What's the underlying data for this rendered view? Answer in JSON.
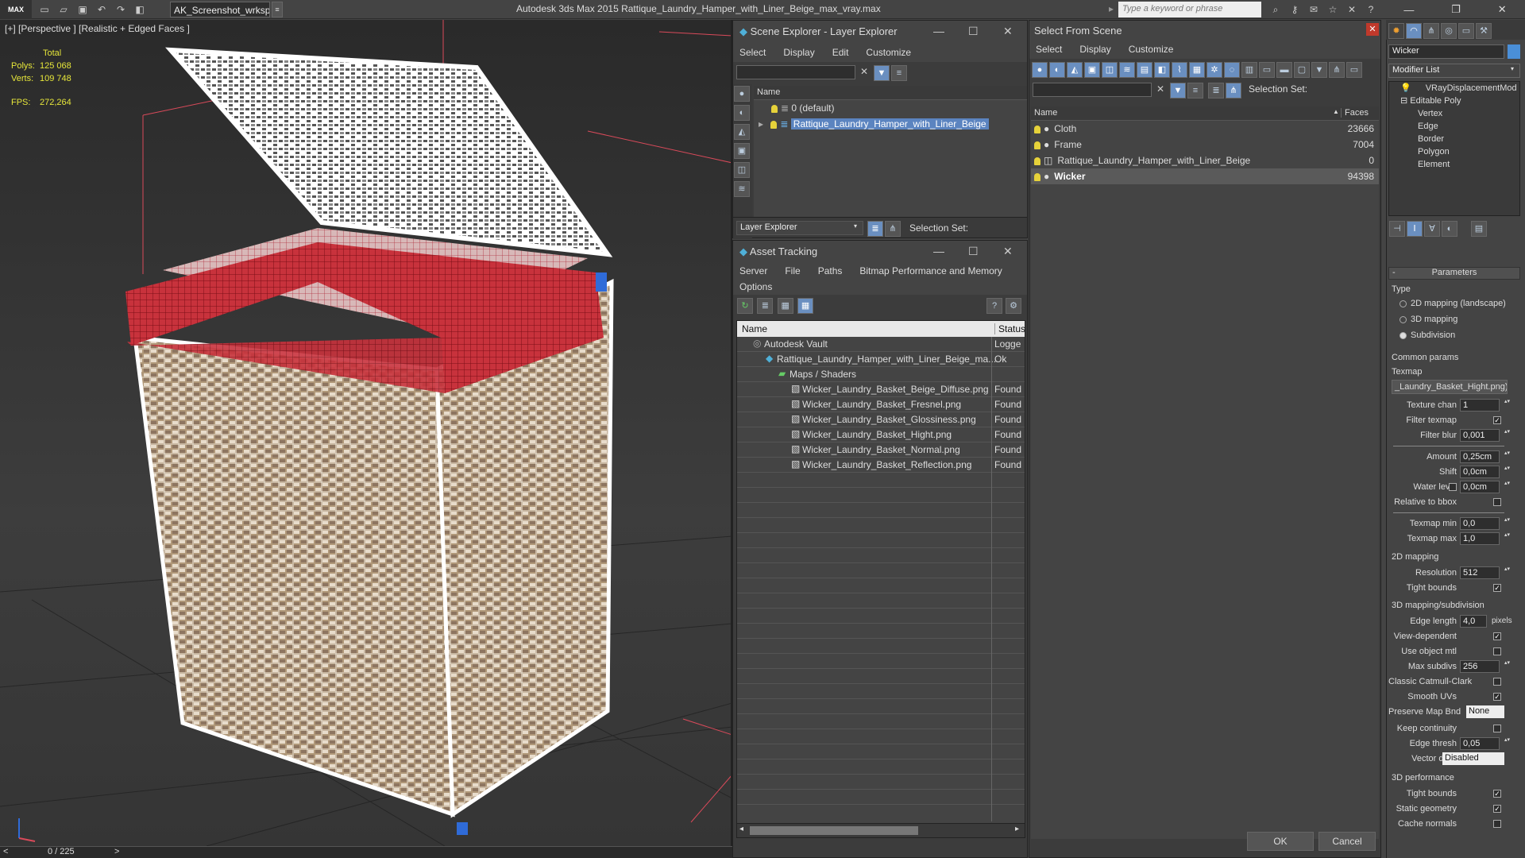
{
  "titlebar": {
    "logo": "MAX",
    "workspace": "AK_Screenshot_wrksp",
    "app_title": "Autodesk 3ds Max  2015     Rattique_Laundry_Hamper_with_Liner_Beige_max_vray.max",
    "search_placeholder": "Type a keyword or phrase"
  },
  "viewport": {
    "label": "[+] [Perspective ] [Realistic + Edged Faces ]",
    "stats": {
      "header": "Total",
      "polys_label": "Polys:",
      "polys": "125 068",
      "verts_label": "Verts:",
      "verts": "109 748"
    },
    "fps_label": "FPS:",
    "fps": "272,264",
    "colors": {
      "wicker": "#c8b39a",
      "liner": "#b0202a",
      "wire": "#ffffff",
      "selected_wire": "#d94a5a"
    }
  },
  "timeline": {
    "prev": "<",
    "count": "0 / 225",
    "next": ">"
  },
  "scene_explorer": {
    "title": "Scene Explorer - Layer Explorer",
    "menu": [
      "Select",
      "Display",
      "Edit",
      "Customize"
    ],
    "column_name": "Name",
    "rows": [
      "0 (default)",
      "Rattique_Laundry_Hamper_with_Liner_Beige"
    ],
    "footer_mode": "Layer Explorer",
    "selection_set": "Selection Set:"
  },
  "asset_tracking": {
    "title": "Asset Tracking",
    "menu1": [
      "Server",
      "File",
      "Paths",
      "Bitmap Performance and Memory"
    ],
    "menu2": [
      "Options"
    ],
    "col_name": "Name",
    "col_status": "Status",
    "rows": [
      {
        "name": "Autodesk Vault",
        "status": "Logge",
        "indent": 0
      },
      {
        "name": "Rattique_Laundry_Hamper_with_Liner_Beige_ma...",
        "status": "Ok",
        "indent": 1
      },
      {
        "name": "Maps / Shaders",
        "status": "",
        "indent": 2
      },
      {
        "name": "Wicker_Laundry_Basket_Beige_Diffuse.png",
        "status": "Found",
        "indent": 3
      },
      {
        "name": "Wicker_Laundry_Basket_Fresnel.png",
        "status": "Found",
        "indent": 3
      },
      {
        "name": "Wicker_Laundry_Basket_Glossiness.png",
        "status": "Found",
        "indent": 3
      },
      {
        "name": "Wicker_Laundry_Basket_Hight.png",
        "status": "Found",
        "indent": 3
      },
      {
        "name": "Wicker_Laundry_Basket_Normal.png",
        "status": "Found",
        "indent": 3
      },
      {
        "name": "Wicker_Laundry_Basket_Reflection.png",
        "status": "Found",
        "indent": 3
      }
    ]
  },
  "select_from_scene": {
    "title": "Select From Scene",
    "menu": [
      "Select",
      "Display",
      "Customize"
    ],
    "selection_set": "Selection Set:",
    "col_name": "Name",
    "col_faces": "Faces",
    "rows": [
      {
        "name": "Cloth",
        "faces": "23666"
      },
      {
        "name": "Frame",
        "faces": "7004"
      },
      {
        "name": "Rattique_Laundry_Hamper_with_Liner_Beige",
        "faces": "0"
      },
      {
        "name": "Wicker",
        "faces": "94398"
      }
    ],
    "ok": "OK",
    "cancel": "Cancel"
  },
  "command_panel": {
    "object_name": "Wicker",
    "modifier_list": "Modifier List",
    "stack": [
      "VRayDisplacementMod",
      "Editable Poly",
      "Vertex",
      "Edge",
      "Border",
      "Polygon",
      "Element"
    ],
    "rollout": "Parameters",
    "type_label": "Type",
    "types": [
      "2D mapping (landscape)",
      "3D mapping",
      "Subdivision"
    ],
    "selected_type": 2,
    "common_params": "Common params",
    "texmap_label": "Texmap",
    "texmap": "_Laundry_Basket_Hight.png)",
    "params": [
      {
        "label": "Texture chan",
        "value": "1"
      },
      {
        "label": "Filter texmap",
        "check": true
      },
      {
        "label": "Filter blur",
        "value": "0,001"
      },
      {
        "label": "Amount",
        "value": "0,25cm"
      },
      {
        "label": "Shift",
        "value": "0,0cm"
      },
      {
        "label": "Water level",
        "value": "0,0cm",
        "check": false
      },
      {
        "label": "Relative to bbox",
        "check": false
      },
      {
        "label": "Texmap min",
        "value": "0,0"
      },
      {
        "label": "Texmap max",
        "value": "1,0"
      }
    ],
    "mapping2d": "2D mapping",
    "resolution_label": "Resolution",
    "resolution": "512",
    "tight_bounds_label": "Tight bounds",
    "mapping3d": "3D mapping/subdivision",
    "edge_length_label": "Edge length",
    "edge_length": "4,0",
    "pixels": "pixels",
    "sub_params": [
      {
        "label": "View-dependent",
        "check": true
      },
      {
        "label": "Use object mtl",
        "check": false
      },
      {
        "label": "Max subdivs",
        "value": "256"
      },
      {
        "label": "Classic Catmull-Clark",
        "check": false
      },
      {
        "label": "Smooth UVs",
        "check": true
      }
    ],
    "preserve_label": "Preserve Map Bnd",
    "preserve": "None",
    "keep_label": "Keep continuity",
    "edge_thresh_label": "Edge thresh",
    "edge_thresh": "0,05",
    "vector_label": "Vector displ",
    "vector": "Disabled",
    "perf": "3D performance",
    "perf_params": [
      {
        "label": "Tight bounds",
        "check": true
      },
      {
        "label": "Static geometry",
        "check": true
      },
      {
        "label": "Cache normals",
        "check": false
      }
    ]
  }
}
